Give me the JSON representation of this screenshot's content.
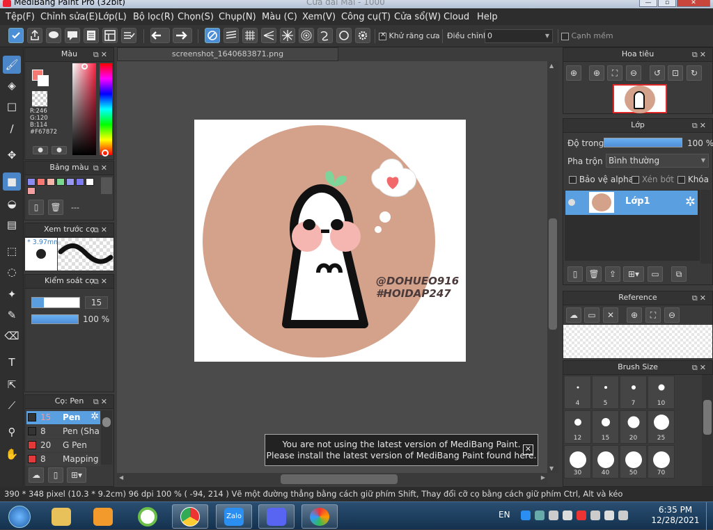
{
  "app": {
    "title": "MediBang Paint Pro (32bit)",
    "title_suffix": "Cửa đãi Mãi - 1000"
  },
  "menu": [
    "Tệp(F)",
    "Chỉnh sửa(E)",
    "Lớp(L)",
    "Bộ lọc(R)",
    "Chọn(S)",
    "Chụp(N)",
    "Màu (C)",
    "Xem(V)",
    "Công cụ(T)",
    "Cửa sổ(W)",
    "Cloud",
    "Help"
  ],
  "toolbar": {
    "antialias_label": "Khử răng cưa",
    "antialias_checked": true,
    "correction_label": "Điều chỉnh",
    "correction_value": "0",
    "edge_label": "Cạnh mềm",
    "edge_checked": false
  },
  "color_panel": {
    "title": "Màu",
    "r": "R:246",
    "g": "G:120",
    "b": "B:114",
    "hex": "#F67872",
    "main_color": "#f67872"
  },
  "palette_panel": {
    "title": "Bảng màu",
    "swatches": [
      "#8a8af0",
      "#f67872",
      "#f5b5a8",
      "#7ad790",
      "#9898f0",
      "#7c7cf0",
      "#ffffff",
      "#f5a0a0"
    ],
    "label": "---"
  },
  "brush_preview": {
    "title": "Xem trước cọ",
    "size": "* 3.97mm"
  },
  "brush_control": {
    "title": "Kiểm soát cọ",
    "size_value": "15",
    "opacity_value": "100 %",
    "size_fraction": 0.25,
    "opacity_fraction": 1.0
  },
  "brushes_panel": {
    "title": "Cọ: Pen",
    "items": [
      {
        "size": "15",
        "name": "Pen",
        "color": "#333333",
        "selected": true
      },
      {
        "size": "8",
        "name": "Pen (Sha",
        "color": "#333333",
        "selected": false
      },
      {
        "size": "20",
        "name": "G Pen",
        "color": "#e23a3a",
        "selected": false
      },
      {
        "size": "8",
        "name": "Mapping",
        "color": "#e23a3a",
        "selected": false
      }
    ]
  },
  "document": {
    "tab_name": "screenshot_1640683871.png"
  },
  "artwork": {
    "line1": "@DOHUEO916",
    "line2": "#HOIDAP247",
    "bg_circle": "#d4a28b",
    "blush": "#f5b5b0"
  },
  "notice": {
    "line1": "You are not using the latest version of MediBang Paint.",
    "line2": "Please install the latest version of MediBang Paint found here."
  },
  "navigator": {
    "title": "Hoa tiêu"
  },
  "layers": {
    "title": "Lớp",
    "opacity_label": "Độ trong",
    "opacity_value": "100 %",
    "opacity_fraction": 1.0,
    "blend_label": "Pha trộn",
    "blend_value": "Bình thường",
    "alpha_protect": "Bảo vệ alpha",
    "clipping": "Xén bớt",
    "lock": "Khóa",
    "layer_name": "Lớp1"
  },
  "reference": {
    "title": "Reference"
  },
  "brush_size": {
    "title": "Brush Size",
    "sizes": [
      "4",
      "5",
      "7",
      "10",
      "12",
      "15",
      "20",
      "25",
      "30",
      "40",
      "50",
      "70"
    ]
  },
  "status": {
    "text": "390 * 348 pixel   (10.3 * 9.2cm)   96 dpi   100 %   ( -94, 214 )   Vẽ một đường thẳng bằng cách giữ phím Shift, Thay đổi cỡ cọ bằng cách giữ phím Ctrl, Alt và kéo"
  },
  "taskbar": {
    "apps": [
      "windows-start",
      "explorer",
      "media-player",
      "app-green",
      "chrome",
      "zalo",
      "discord",
      "medibang"
    ],
    "lang": "EN",
    "time": "6:35 PM",
    "date": "12/28/2021"
  }
}
